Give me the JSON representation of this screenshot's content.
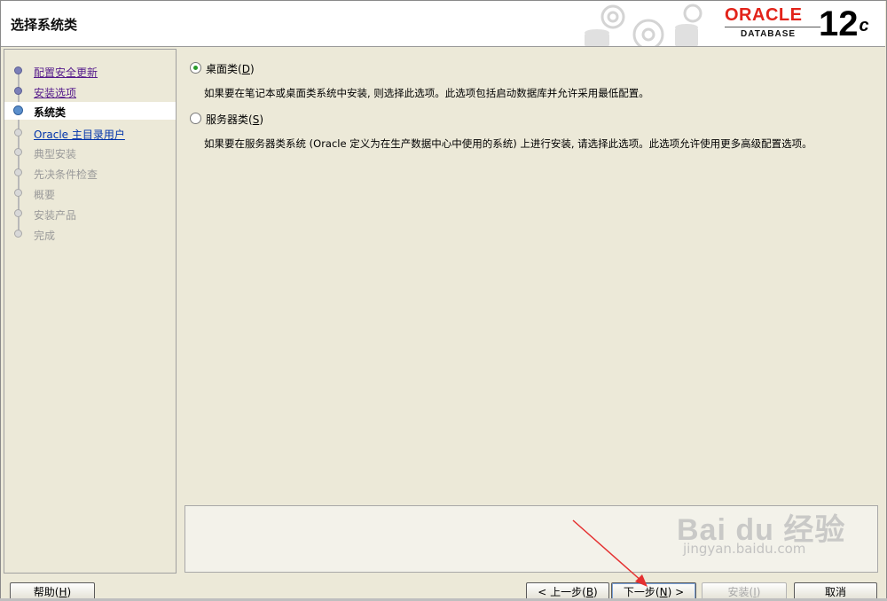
{
  "header": {
    "title": "选择系统类",
    "brand": "ORACLE",
    "product": "DATABASE",
    "version": "12",
    "version_suffix": "c"
  },
  "nav": {
    "steps": [
      {
        "label": "配置安全更新",
        "state": "done"
      },
      {
        "label": "安装选项",
        "state": "done"
      },
      {
        "label": "系统类",
        "state": "current"
      },
      {
        "label": "Oracle 主目录用户",
        "state": "link"
      },
      {
        "label": "典型安装",
        "state": "pending"
      },
      {
        "label": "先决条件检查",
        "state": "pending"
      },
      {
        "label": "概要",
        "state": "pending"
      },
      {
        "label": "安装产品",
        "state": "pending"
      },
      {
        "label": "完成",
        "state": "pending"
      }
    ]
  },
  "options": {
    "desktop": {
      "label": "桌面类",
      "mnemonic": "D",
      "selected": true,
      "description": "如果要在笔记本或桌面类系统中安装, 则选择此选项。此选项包括启动数据库并允许采用最低配置。"
    },
    "server": {
      "label": "服务器类",
      "mnemonic": "S",
      "selected": false,
      "description": "如果要在服务器类系统 (Oracle 定义为在生产数据中心中使用的系统) 上进行安装, 请选择此选项。此选项允许使用更多高级配置选项。"
    }
  },
  "footer": {
    "help": {
      "label": "帮助",
      "mnemonic": "H"
    },
    "back": {
      "label": "< 上一步",
      "mnemonic": "B"
    },
    "next": {
      "label": "下一步",
      "mnemonic": "N",
      "suffix": " >"
    },
    "install": {
      "label": "安装",
      "mnemonic": "I"
    },
    "cancel": {
      "label": "取消"
    }
  },
  "watermark": {
    "brand": "Bai du 经验",
    "url": "jingyan.baidu.com"
  },
  "colors": {
    "oracle_red": "#e2231a",
    "radio_selected": "#2a9b2a",
    "annotation_arrow": "#e53030"
  }
}
